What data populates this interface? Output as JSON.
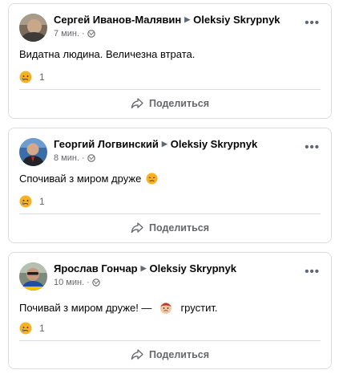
{
  "posts": [
    {
      "author": "Сергей Иванов-Малявин",
      "target": "Oleksiy Skrypnyk",
      "time": "7 мин.",
      "separator": "·",
      "text": "Видатна людина. Величезна втрата.",
      "reaction_count": "1",
      "share_label": "Поделиться"
    },
    {
      "author": "Георгий Логвинский",
      "target": "Oleksiy Skrypnyk",
      "time": "8 мин.",
      "separator": "·",
      "text": "Спочивай з миром друже",
      "reaction_count": "1",
      "share_label": "Поделиться"
    },
    {
      "author": "Ярослав Гончар",
      "target": "Oleksiy Skrypnyk",
      "time": "10 мин.",
      "separator": "·",
      "text": "Почивай з миром друже! —",
      "text_suffix": "грустит.",
      "reaction_count": "1",
      "share_label": "Поделиться"
    }
  ],
  "icons": {
    "more": "more-options-icon",
    "globe": "globe-icon",
    "sad": "sad-reaction-icon",
    "share": "share-icon",
    "arrow": "arrow-right-icon"
  },
  "colors": {
    "text": "#050505",
    "secondary": "#65676b",
    "border": "#dadde1",
    "reaction_yellow": "#f7b125"
  }
}
